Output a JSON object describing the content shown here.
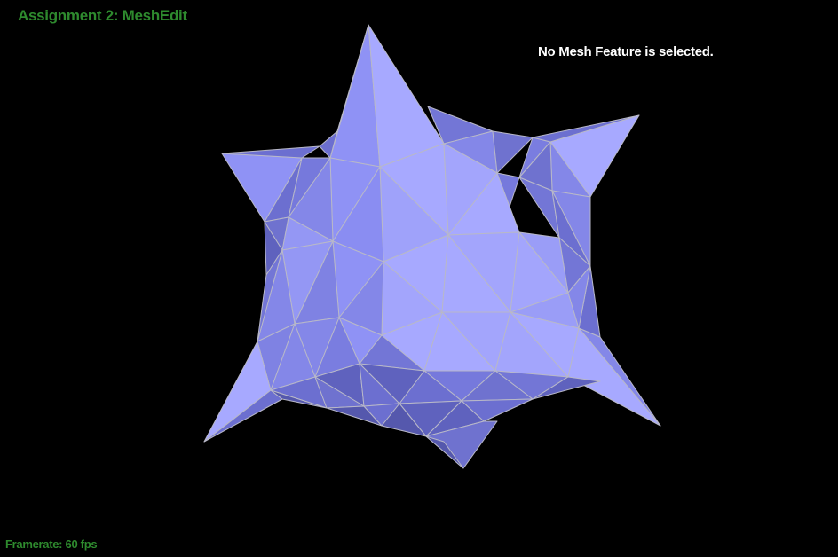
{
  "app": {
    "title": "Assignment 2: MeshEdit"
  },
  "status": {
    "selection": "No Mesh Feature is selected."
  },
  "footer": {
    "framerate": "Framerate: 60 fps"
  },
  "colors": {
    "background": "#000000",
    "hud_green": "#2e8a2e",
    "status_text": "#ffffff",
    "mesh_light": "#a7a9ff",
    "mesh_mid": "#8f92f5",
    "mesh_dark": "#6c6fd0",
    "mesh_shadow": "#5558ad",
    "mesh_edge": "#b8b8c8"
  }
}
